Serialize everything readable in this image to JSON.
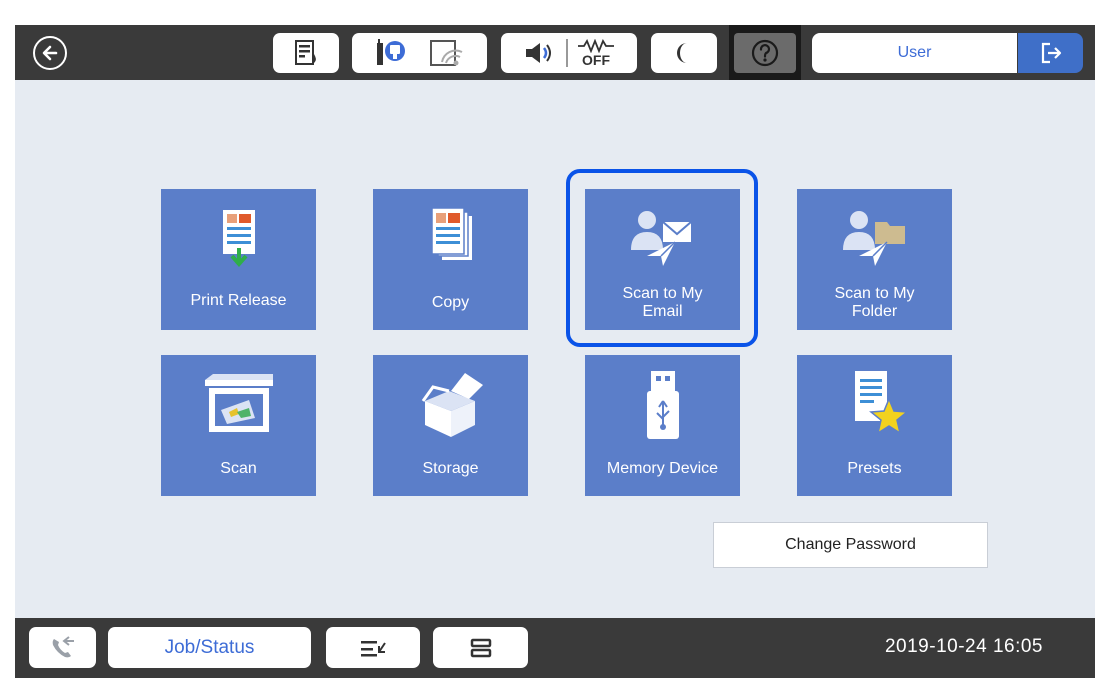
{
  "topbar": {
    "user_label": "User",
    "off_label": "OFF"
  },
  "tiles": [
    {
      "label_1": "Print Release",
      "label_2": ""
    },
    {
      "label_1": "Copy",
      "label_2": ""
    },
    {
      "label_1": "Scan to My",
      "label_2": "Email"
    },
    {
      "label_1": "Scan to My",
      "label_2": "Folder"
    },
    {
      "label_1": "Scan",
      "label_2": ""
    },
    {
      "label_1": "Storage",
      "label_2": ""
    },
    {
      "label_1": "Memory Device",
      "label_2": ""
    },
    {
      "label_1": "Presets",
      "label_2": ""
    }
  ],
  "change_password_label": "Change Password",
  "bottombar": {
    "job_status_label": "Job/Status",
    "datetime": "2019-10-24 16:05"
  },
  "colors": {
    "tile": "#5b7ec9",
    "selection": "#0a53e8",
    "accent": "#3f6fc8",
    "bar": "#3a3a3a",
    "background": "#e6ebf2"
  },
  "selected_tile": "Scan to My Email"
}
